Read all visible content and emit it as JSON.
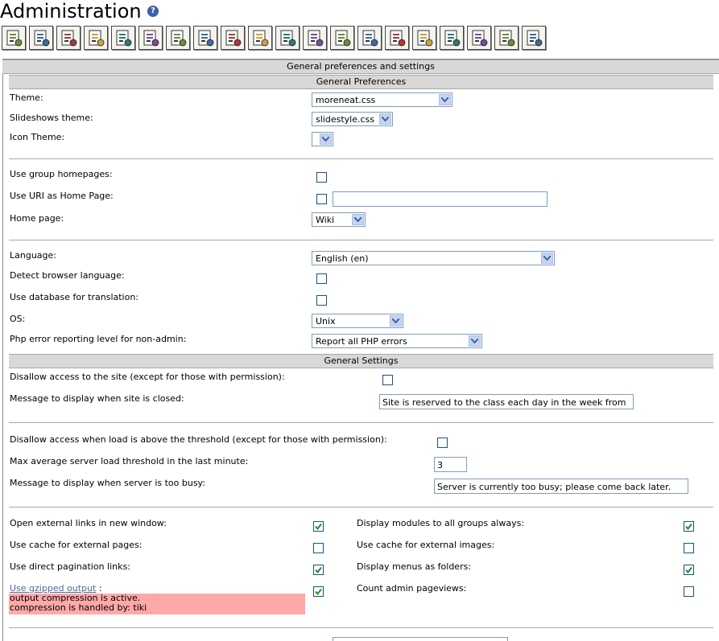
{
  "header": {
    "title": "Administration",
    "help_icon": "help-icon"
  },
  "toolbar": {
    "icons": [
      "features-icon",
      "login-icon",
      "profiles-icon",
      "wiki-icon",
      "gallery-icon",
      "file-gallery-icon",
      "blogs-icon",
      "forums-icon",
      "faqs-icon",
      "maps-icon",
      "articles-icon",
      "faq-icon",
      "trackers-icon",
      "webmail-icon",
      "directory-icon",
      "polls-icon",
      "images-icon",
      "meta-tags-icon",
      "search-icon",
      "textarea-icon"
    ]
  },
  "sections": {
    "main_header": "General preferences and settings",
    "prefs_header": "General Preferences",
    "settings_header": "General Settings"
  },
  "prefs": {
    "theme_label": "Theme:",
    "theme_value": "moreneat.css",
    "slideshows_label": "Slideshows theme:",
    "slideshows_value": "slidestyle.css",
    "icon_theme_label": "Icon Theme:",
    "icon_theme_value": "",
    "group_home_label": "Use group homepages:",
    "uri_home_label": "Use URI as Home Page:",
    "uri_home_value": "",
    "home_page_label": "Home page:",
    "home_page_value": "Wiki",
    "language_label": "Language:",
    "language_value": "English (en)",
    "detect_lang_label": "Detect browser language:",
    "db_translation_label": "Use database for translation:",
    "os_label": "OS:",
    "os_value": "Unix",
    "php_error_label": "Php error reporting level for non-admin:",
    "php_error_value": "Report all PHP errors"
  },
  "settings": {
    "disallow_label": "Disallow access to the site (except for those with permission):",
    "closed_msg_label": "Message to display when site is closed:",
    "closed_msg_value": "Site is reserved to the class each day in the week from",
    "disallow_load_label": "Disallow access when load is above the threshold (except for those with permission):",
    "max_load_label": "Max average server load threshold in the last minute:",
    "max_load_value": "3",
    "busy_msg_label": "Message to display when server is too busy:",
    "busy_msg_value": "Server is currently too busy; please come back later.",
    "ext_links_label": "Open external links in new window:",
    "cache_pages_label": "Use cache for external pages:",
    "direct_pagination_label": "Use direct pagination links:",
    "gzip_label": "Use gzipped output",
    "gzip_suffix": ":",
    "gzip_status_1": "output compression is active.",
    "gzip_status_2": "compression is handled by: tiki",
    "modules_all_label": "Display modules to all groups always:",
    "cache_images_label": "Use cache for external images:",
    "menus_folders_label": "Display menus as folders:",
    "admin_pageviews_label": "Count admin pageviews:"
  },
  "checkboxes": {
    "group_home": false,
    "uri_home": false,
    "detect_lang": false,
    "db_translation": false,
    "disallow": false,
    "disallow_load": false,
    "ext_links": true,
    "cache_pages": false,
    "direct_pagination": true,
    "gzip": true,
    "modules_all": true,
    "cache_images": false,
    "menus_folders": true,
    "admin_pageviews": false
  },
  "colors": {
    "band": "#d8d8d8",
    "error_bg": "#ffa8a8",
    "check": "#2a8a2a"
  }
}
